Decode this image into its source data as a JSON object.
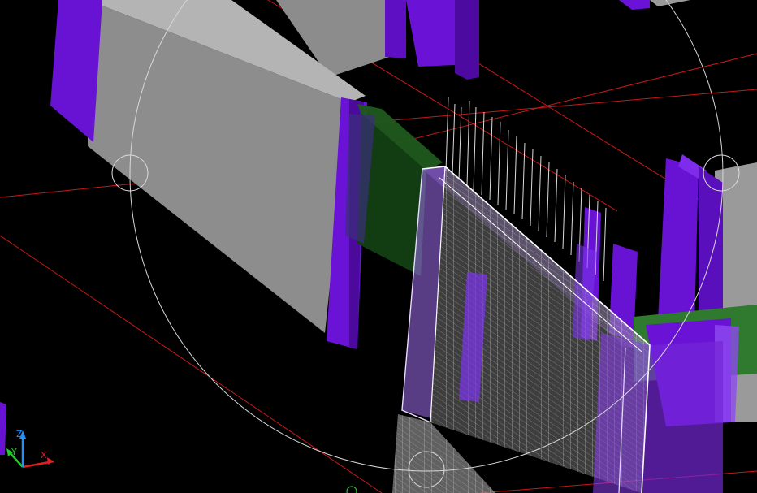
{
  "viewport": {
    "background": "#000000",
    "colors": {
      "gray_face": "#8a8a8a",
      "gray_top": "#b5b5b5",
      "purple_front": "#6a0fcf",
      "purple_side": "#4b0a9c",
      "green": "#1f5a1f",
      "grid_red": "#c81818",
      "orbit": "#d8d8d8",
      "selection": "#c9b3ff"
    }
  },
  "ucs_icon": {
    "x_label": "X",
    "y_label": "Y",
    "z_label": "Z",
    "x_color": "#e02020",
    "y_color": "#20d020",
    "z_color": "#2090ff"
  },
  "orbit": {
    "name": "3d-orbit-arcball"
  }
}
